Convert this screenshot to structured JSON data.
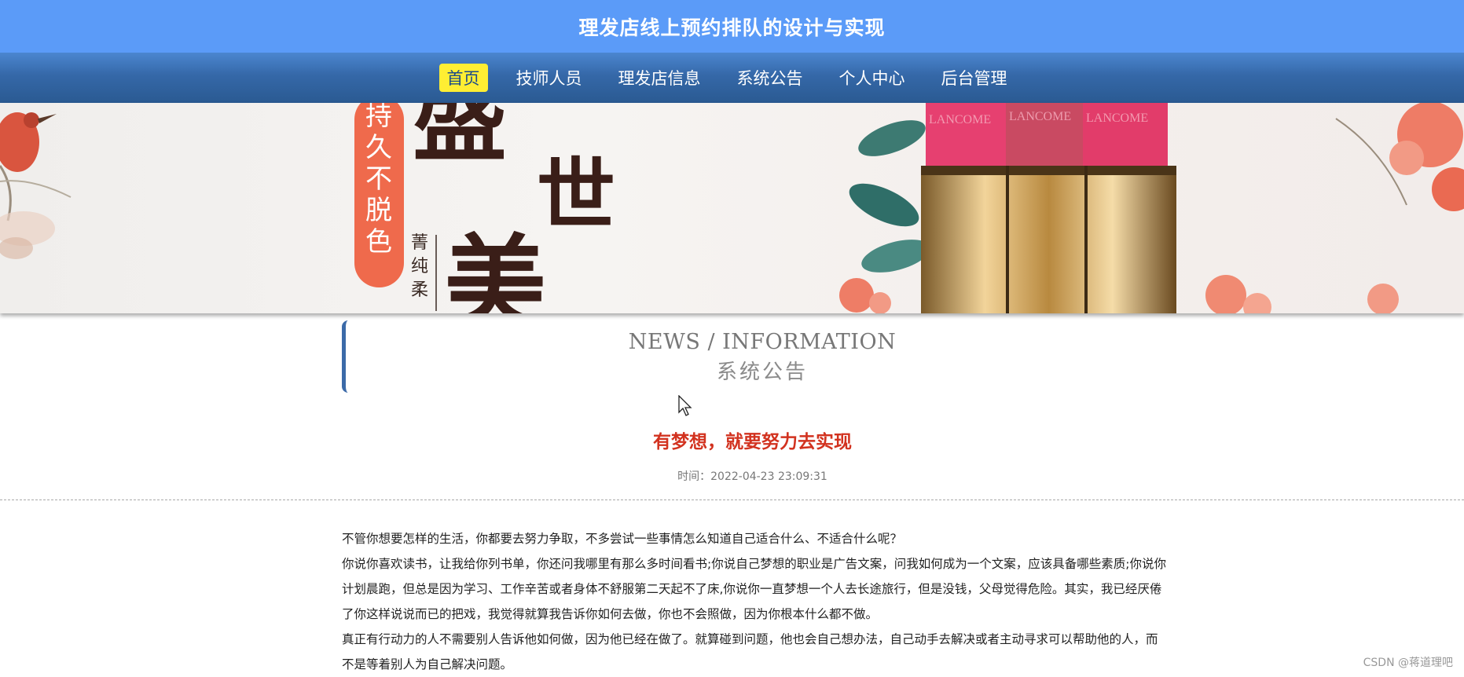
{
  "header": {
    "title": "理发店线上预约排队的设计与实现"
  },
  "nav": {
    "items": [
      "首页",
      "技师人员",
      "理发店信息",
      "系统公告",
      "个人中心",
      "后台管理"
    ],
    "active_index": 0
  },
  "banner": {
    "vertical_tag": "持久不脱色",
    "big_chars": [
      "盛",
      "世",
      "美"
    ],
    "small_text": "菁纯柔",
    "lipstick_brand": "LANCOME"
  },
  "section": {
    "title_en": "NEWS / INFORMATION",
    "title_cn": "系统公告"
  },
  "article": {
    "title": "有梦想，就要努力去实现",
    "meta": "时间：2022-04-23 23:09:31",
    "paragraphs": [
      "不管你想要怎样的生活，你都要去努力争取，不多尝试一些事情怎么知道自己适合什么、不适合什么呢？",
      "你说你喜欢读书，让我给你列书单，你还问我哪里有那么多时间看书;你说自己梦想的职业是广告文案，问我如何成为一个文案，应该具备哪些素质;你说你计划晨跑，但总是因为学习、工作辛苦或者身体不舒服第二天起不了床,你说你一直梦想一个人去长途旅行，但是没钱，父母觉得危险。其实，我已经厌倦了你这样说说而已的把戏，我觉得就算我告诉你如何去做，你也不会照做，因为你根本什么都不做。",
      "真正有行动力的人不需要别人告诉他如何做，因为他已经在做了。就算碰到问题，他也会自己想办法，自己动手去解决或者主动寻求可以帮助他的人，而不是等着别人为自己解决问题。"
    ]
  },
  "watermark": "CSDN @蒋道理吧",
  "colors": {
    "title_bar": "#5b9bf8",
    "nav_active_bg": "#ffee33",
    "article_title": "#d2321f",
    "section_border": "#3b6aa8"
  }
}
